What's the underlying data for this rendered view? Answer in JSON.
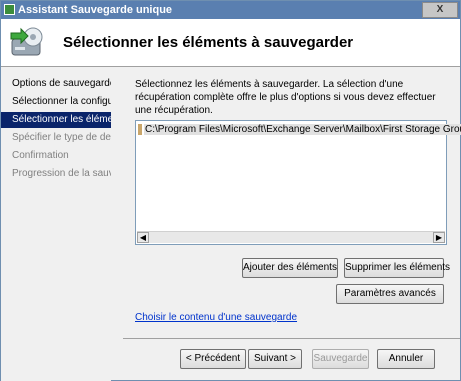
{
  "window": {
    "title": "Assistant Sauvegarde unique",
    "close_label": "X"
  },
  "header": {
    "title": "Sélectionner les éléments à sauvegarder"
  },
  "sidebar": {
    "items": [
      {
        "label": "Options de sauvegarde",
        "state": "normal"
      },
      {
        "label": "Sélectionner la configu...",
        "state": "normal"
      },
      {
        "label": "Sélectionner les éléme...",
        "state": "active"
      },
      {
        "label": "Spécifier le type de de...",
        "state": "disabled"
      },
      {
        "label": "Confirmation",
        "state": "disabled"
      },
      {
        "label": "Progression de la sauv...",
        "state": "disabled"
      }
    ]
  },
  "main": {
    "description": "Sélectionnez les éléments à sauvegarder. La sélection d'une récupération complète offre le plus d'options si vous devez effectuer une récupération.",
    "list_items": [
      "C:\\Program Files\\Microsoft\\Exchange Server\\Mailbox\\First Storage Group"
    ],
    "add_button": "Ajouter des éléments",
    "remove_button": "Supprimer les éléments",
    "advanced_button": "Paramètres avancés",
    "link": "Choisir le contenu d'une sauvegarde"
  },
  "footer": {
    "back": "< Précédent",
    "next": "Suivant >",
    "backup": "Sauvegarde",
    "cancel": "Annuler"
  },
  "colors": {
    "titlebar": "#5a7fb0",
    "selection": "#0a246a",
    "link": "#0033cc"
  }
}
